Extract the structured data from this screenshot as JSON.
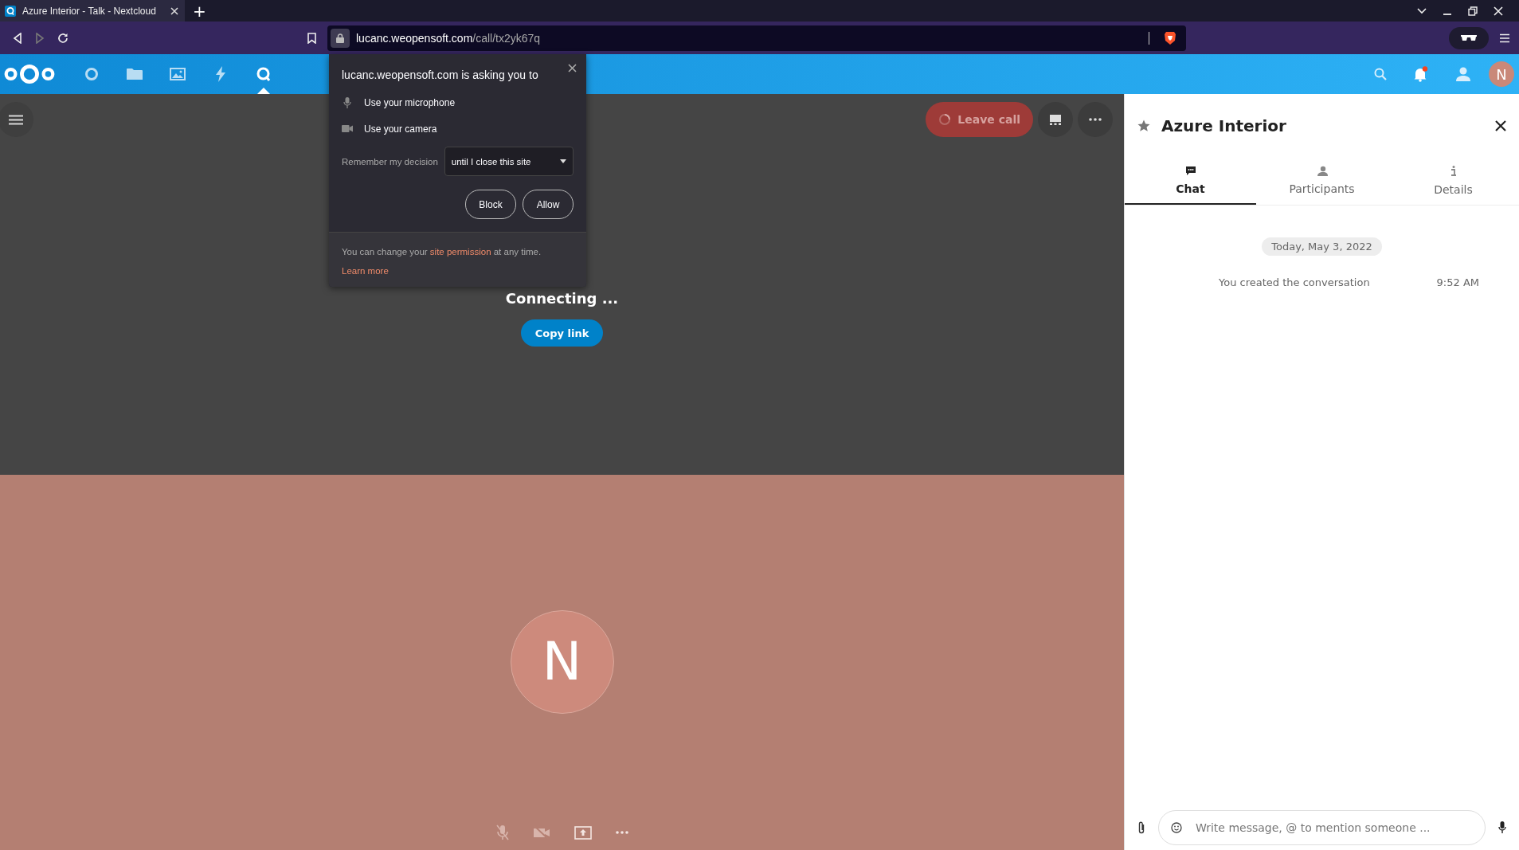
{
  "browser": {
    "tab_title": "Azure Interior - Talk - Nextcloud",
    "new_tab": "+",
    "url_host": "lucanc.weopensoft.com",
    "url_path": "/call/tx2yk67q"
  },
  "app_nav": [
    {
      "kind": "dashboard",
      "selected": false
    },
    {
      "kind": "files",
      "selected": false
    },
    {
      "kind": "photos",
      "selected": false
    },
    {
      "kind": "activity",
      "selected": false
    },
    {
      "kind": "talk",
      "selected": true
    }
  ],
  "header": {
    "unread_notifications": true,
    "avatar_letter": "N"
  },
  "permission_prompt": {
    "title": "lucanc.weopensoft.com is asking you to",
    "requests": [
      {
        "kind": "microphone",
        "label": "Use your microphone"
      },
      {
        "kind": "camera",
        "label": "Use your camera"
      }
    ],
    "remember_label": "Remember my decision",
    "remember_value": "until I close this site",
    "buttons": [
      "Block",
      "Allow"
    ],
    "footer_before": "You can change your",
    "footer_link": "site permission",
    "footer_after": "at any time.",
    "learn_more": "Learn more"
  },
  "call": {
    "leave_button": "Leave call",
    "status": "Connecting ...",
    "copy_link": "Copy link",
    "avatar_letter": "N",
    "controls": [
      {
        "kind": "mic-off"
      },
      {
        "kind": "camera-off"
      },
      {
        "kind": "screen-share"
      },
      {
        "kind": "more"
      }
    ]
  },
  "sidebar": {
    "title": "Azure Interior",
    "tabs": [
      {
        "kind": "chat",
        "label": "Chat",
        "selected": true
      },
      {
        "kind": "participants",
        "label": "Participants",
        "selected": false
      },
      {
        "kind": "details",
        "label": "Details",
        "selected": false
      }
    ],
    "date": "Today, May 3, 2022",
    "messages": [
      {
        "text": "You created the conversation",
        "time": "9:52 AM"
      }
    ],
    "composer_placeholder": "Write message, @ to mention someone ..."
  }
}
